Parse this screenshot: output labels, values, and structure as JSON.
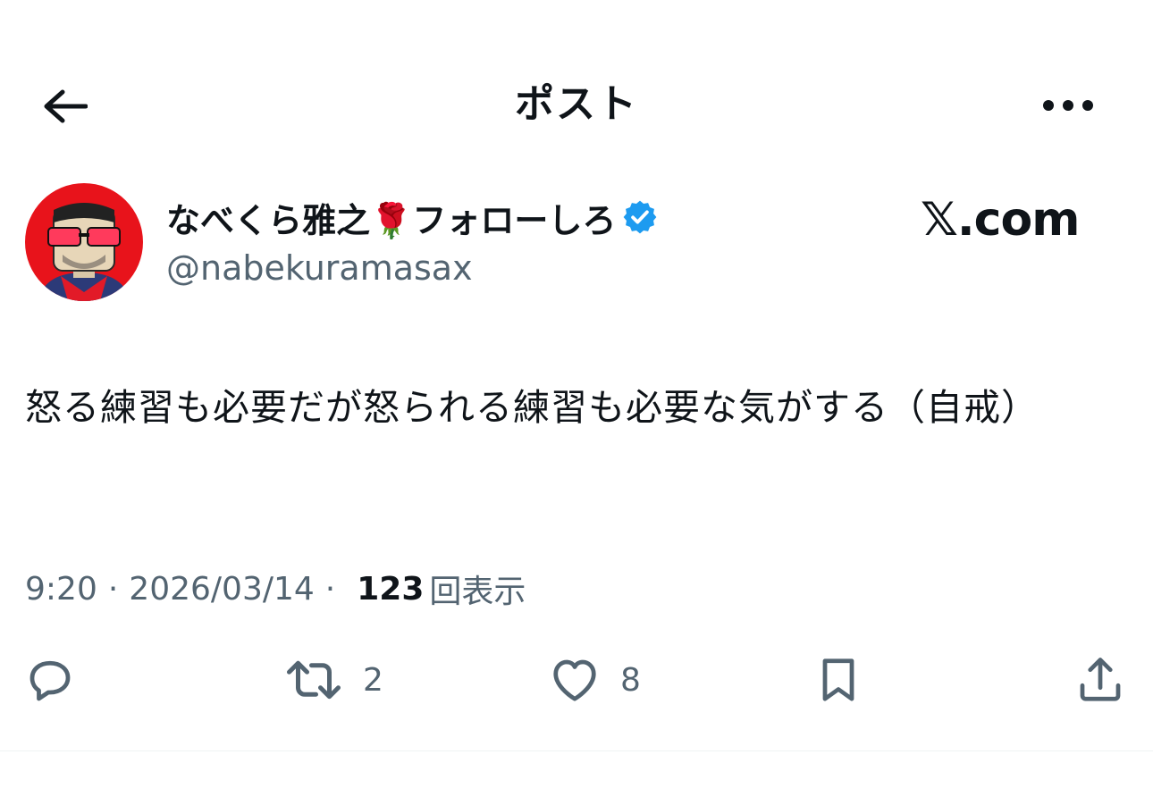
{
  "header": {
    "title": "ポスト",
    "back_icon": "arrow-left-icon",
    "more_icon": "more-horizontal-icon"
  },
  "author": {
    "display_name": "なべくら雅之🌹フォローしろ",
    "handle": "@nabekuramasax",
    "verified": true,
    "verified_color": "#1d9bf0",
    "avatar_bg": "#e8131b"
  },
  "watermark": "𝕏.com",
  "post": {
    "text": "怒る練習も必要だが怒られる練習も必要な気がする（自戒）"
  },
  "meta": {
    "time": "9:20",
    "separator": "·",
    "date": "2026/03/14",
    "views_count": "123",
    "views_label": "回表示"
  },
  "actions": {
    "reply_icon": "reply-bubble-icon",
    "retweet_icon": "retweet-icon",
    "retweet_count": "2",
    "like_icon": "heart-icon",
    "like_count": "8",
    "bookmark_icon": "bookmark-icon",
    "share_icon": "share-icon"
  },
  "colors": {
    "text_primary": "#0f1419",
    "text_secondary": "#536471",
    "accent": "#1d9bf0"
  }
}
